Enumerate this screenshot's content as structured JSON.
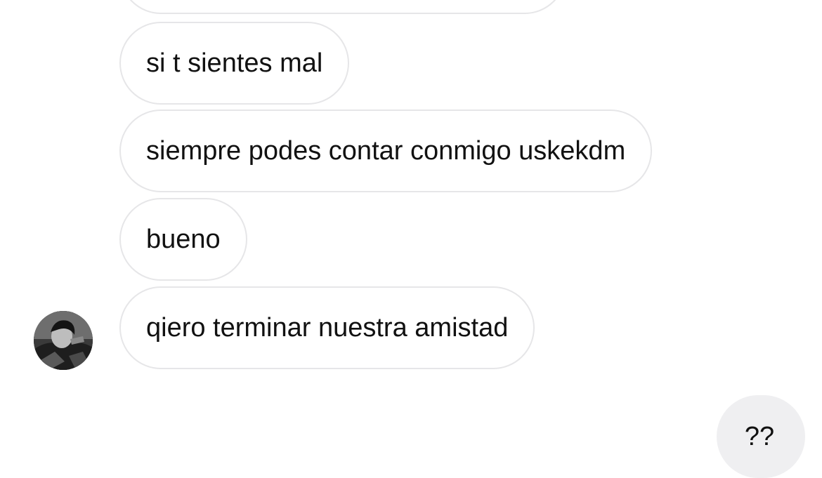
{
  "received_messages": [
    "si t sientes mal",
    "siempre podes contar conmigo uskekdm",
    "bueno",
    "qiero terminar nuestra amistad"
  ],
  "sent_messages": [
    "??"
  ],
  "icons": {
    "avatar": "profile-photo-avatar"
  }
}
